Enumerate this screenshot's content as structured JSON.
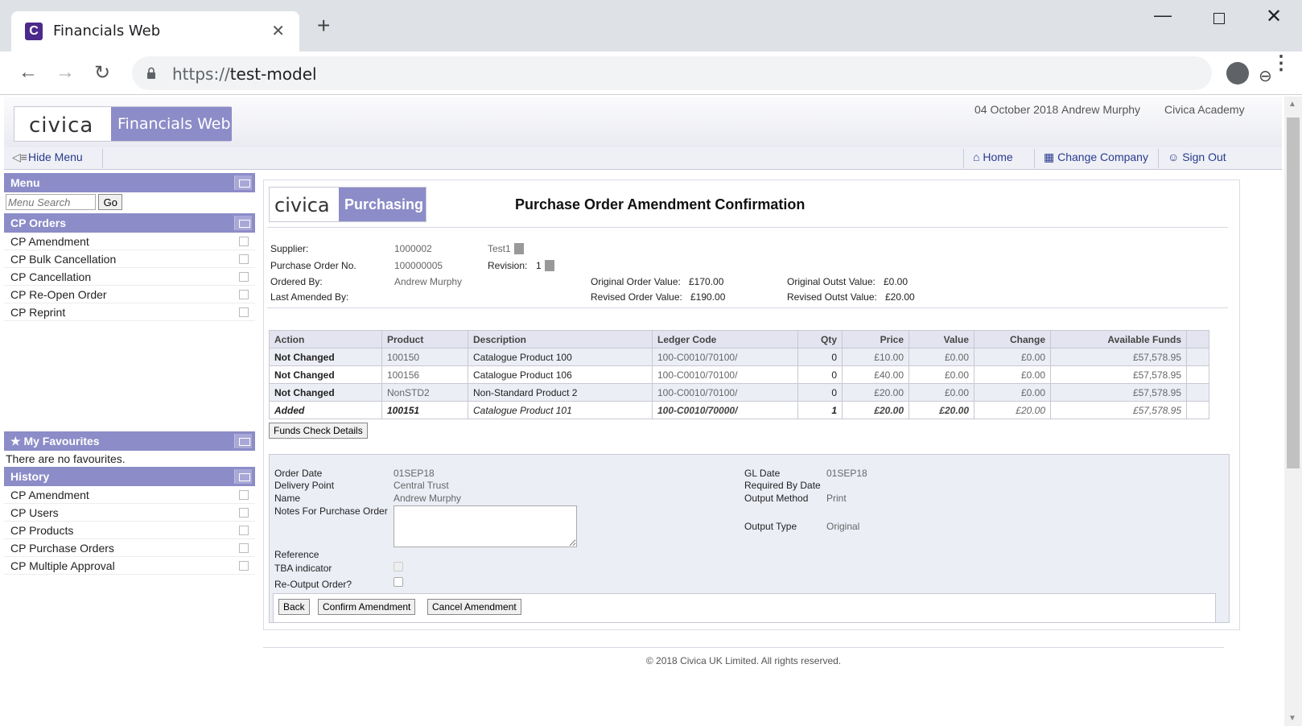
{
  "browser": {
    "tab_title": "Financials Web",
    "url_scheme": "https://",
    "url_host": "test-model"
  },
  "header": {
    "brand": "civica",
    "product": "Financials Web",
    "date": "04 October 2018",
    "user": "Andrew Murphy",
    "company": "Civica Academy"
  },
  "menubar": {
    "hide_menu": "Hide Menu",
    "home": "Home",
    "change_company": "Change Company",
    "sign_out": "Sign Out"
  },
  "sidebar": {
    "menu_title": "Menu",
    "search_placeholder": "Menu Search",
    "go_label": "Go",
    "cp_orders_title": "CP Orders",
    "cp_orders": [
      "CP Amendment",
      "CP Bulk Cancellation",
      "CP Cancellation",
      "CP Re-Open Order",
      "CP Reprint"
    ],
    "favourites_title": "My Favourites",
    "no_favourites": "There are no favourites.",
    "history_title": "History",
    "history": [
      "CP Amendment",
      "CP Users",
      "CP Products",
      "CP Purchase Orders",
      "CP Multiple Approval"
    ]
  },
  "page": {
    "brand": "civica",
    "product": "Purchasing",
    "title": "Purchase Order Amendment Confirmation"
  },
  "summary": {
    "supplier_label": "Supplier:",
    "supplier_code": "1000002",
    "supplier_name": "Test1",
    "po_label": "Purchase Order No.",
    "po_number": "100000005",
    "revision_label": "Revision:",
    "revision": "1",
    "ordered_by_label": "Ordered By:",
    "ordered_by": "Andrew Murphy",
    "last_amended_label": "Last Amended By:",
    "orig_order_label": "Original Order Value:",
    "orig_order": "£170.00",
    "rev_order_label": "Revised Order Value:",
    "rev_order": "£190.00",
    "orig_outst_label": "Original Outst Value:",
    "orig_outst": "£0.00",
    "rev_outst_label": "Revised Outst Value:",
    "rev_outst": "£20.00"
  },
  "lines": {
    "columns": [
      "Action",
      "Product",
      "Description",
      "Ledger Code",
      "Qty",
      "Price",
      "Value",
      "Change",
      "Available Funds"
    ],
    "rows": [
      [
        "Not Changed",
        "100150",
        "Catalogue Product 100",
        "100-C0010/70100/",
        "0",
        "£10.00",
        "£0.00",
        "£0.00",
        "£57,578.95"
      ],
      [
        "Not Changed",
        "100156",
        "Catalogue Product 106",
        "100-C0010/70100/",
        "0",
        "£40.00",
        "£0.00",
        "£0.00",
        "£57,578.95"
      ],
      [
        "Not Changed",
        "NonSTD2",
        "Non-Standard Product 2",
        "100-C0010/70100/",
        "0",
        "£20.00",
        "£0.00",
        "£0.00",
        "£57,578.95"
      ],
      [
        "Added",
        "100151",
        "Catalogue Product 101",
        "100-C0010/70000/",
        "1",
        "£20.00",
        "£20.00",
        "£20.00",
        "£57,578.95"
      ]
    ],
    "funds_check_label": "Funds Check Details"
  },
  "details": {
    "order_date_label": "Order Date",
    "order_date": "01SEP18",
    "delivery_label": "Delivery Point",
    "delivery": "Central Trust",
    "name_label": "Name",
    "name": "Andrew Murphy",
    "notes_label": "Notes For Purchase Order",
    "reference_label": "Reference",
    "tba_label": "TBA indicator",
    "reoutput_label": "Re-Output Order?",
    "gl_date_label": "GL Date",
    "gl_date": "01SEP18",
    "required_label": "Required By Date",
    "output_method_label": "Output Method",
    "output_method": "Print",
    "output_type_label": "Output Type",
    "output_type": "Original"
  },
  "actions": {
    "back": "Back",
    "confirm": "Confirm Amendment",
    "cancel": "Cancel Amendment"
  },
  "footer": "© 2018 Civica UK Limited. All rights reserved."
}
